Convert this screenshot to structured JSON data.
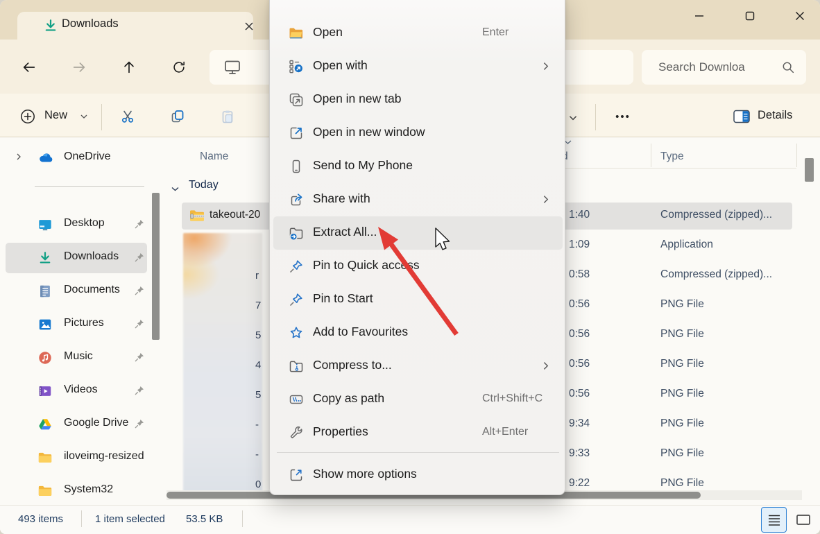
{
  "titlebar": {
    "tab_title": "Downloads"
  },
  "navbar": {
    "search_placeholder": "Search Downloa"
  },
  "toolbar": {
    "new_label": "New",
    "more_label": "•••",
    "details_label": "Details"
  },
  "sidebar": {
    "items": [
      {
        "label": "OneDrive"
      },
      {
        "label": "Desktop"
      },
      {
        "label": "Downloads"
      },
      {
        "label": "Documents"
      },
      {
        "label": "Pictures"
      },
      {
        "label": "Music"
      },
      {
        "label": "Videos"
      },
      {
        "label": "Google Drive"
      },
      {
        "label": "iloveimg-resized"
      },
      {
        "label": "System32"
      }
    ]
  },
  "columns": {
    "name": "Name",
    "date_clipped": "d",
    "type": "Type"
  },
  "filelist": {
    "group": "Today",
    "selected_name": "takeout-20",
    "rows": [
      {
        "time": "1:40",
        "type": "Compressed (zipped)..."
      },
      {
        "time": "1:09",
        "type": "Application"
      },
      {
        "time": "0:58",
        "type": "Compressed (zipped)..."
      },
      {
        "time": "0:56",
        "type": "PNG File"
      },
      {
        "time": "0:56",
        "type": "PNG File"
      },
      {
        "time": "0:56",
        "type": "PNG File"
      },
      {
        "time": "0:56",
        "type": "PNG File"
      },
      {
        "time": "9:34",
        "type": "PNG File"
      },
      {
        "time": "9:33",
        "type": "PNG File"
      },
      {
        "time": "9:22",
        "type": "PNG File"
      }
    ],
    "clipped_fragments": [
      "r",
      "7",
      "5",
      "4",
      "5",
      "-",
      "-",
      "0"
    ]
  },
  "menu": {
    "items": [
      {
        "label": "Open",
        "shortcut": "Enter"
      },
      {
        "label": "Open with"
      },
      {
        "label": "Open in new tab"
      },
      {
        "label": "Open in new window"
      },
      {
        "label": "Send to My Phone"
      },
      {
        "label": "Share with"
      },
      {
        "label": "Extract All..."
      },
      {
        "label": "Pin to Quick access"
      },
      {
        "label": "Pin to Start"
      },
      {
        "label": "Add to Favourites"
      },
      {
        "label": "Compress to..."
      },
      {
        "label": "Copy as path",
        "shortcut": "Ctrl+Shift+C"
      },
      {
        "label": "Properties",
        "shortcut": "Alt+Enter"
      },
      {
        "label": "Show more options"
      }
    ]
  },
  "statusbar": {
    "count": "493 items",
    "selected": "1 item selected",
    "size": "53.5 KB"
  },
  "colors": {
    "accent_blue": "#1670c6",
    "teal": "#12a085",
    "arrow_red": "#e23b35",
    "titlebar_beige": "#e8dcc2"
  }
}
